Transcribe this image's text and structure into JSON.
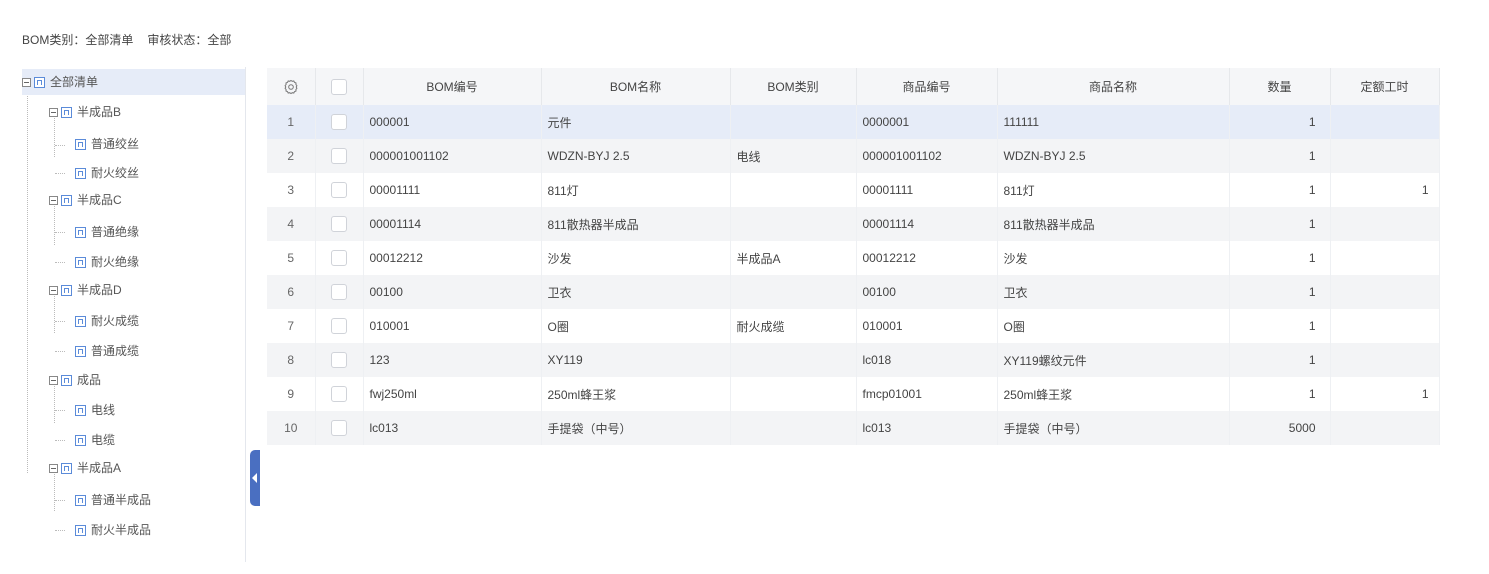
{
  "filter": {
    "category_label": "BOM类别：",
    "category_value": "全部清单",
    "status_label": "审核状态：",
    "status_value": "全部"
  },
  "tree": {
    "root": "全部清单",
    "groups": [
      {
        "label": "半成品B",
        "children": [
          "普通绞丝",
          "耐火绞丝"
        ]
      },
      {
        "label": "半成品C",
        "children": [
          "普通绝缘",
          "耐火绝缘"
        ]
      },
      {
        "label": "半成品D",
        "children": [
          "耐火成缆",
          "普通成缆"
        ]
      },
      {
        "label": "成品",
        "children": [
          "电线",
          "电缆"
        ]
      },
      {
        "label": "半成品A",
        "children": [
          "普通半成品",
          "耐火半成品"
        ]
      }
    ]
  },
  "table": {
    "settings_icon": "gear-icon",
    "columns": [
      "BOM编号",
      "BOM名称",
      "BOM类别",
      "商品编号",
      "商品名称",
      "数量",
      "定额工时"
    ],
    "rows": [
      {
        "idx": "1",
        "code": "000001",
        "name": "元件",
        "category": "",
        "product_code": "0000001",
        "product_name": "111111",
        "qty": "1",
        "hours": ""
      },
      {
        "idx": "2",
        "code": "000001001102",
        "name": "WDZN-BYJ 2.5",
        "category": "电线",
        "product_code": "000001001102",
        "product_name": "WDZN-BYJ 2.5",
        "qty": "1",
        "hours": ""
      },
      {
        "idx": "3",
        "code": "00001111",
        "name": "811灯",
        "category": "",
        "product_code": "00001111",
        "product_name": "811灯",
        "qty": "1",
        "hours": "1"
      },
      {
        "idx": "4",
        "code": "00001114",
        "name": "811散热器半成品",
        "category": "",
        "product_code": "00001114",
        "product_name": "811散热器半成品",
        "qty": "1",
        "hours": ""
      },
      {
        "idx": "5",
        "code": "00012212",
        "name": "沙发",
        "category": "半成品A",
        "product_code": "00012212",
        "product_name": "沙发",
        "qty": "1",
        "hours": ""
      },
      {
        "idx": "6",
        "code": "00100",
        "name": "卫衣",
        "category": "",
        "product_code": "00100",
        "product_name": "卫衣",
        "qty": "1",
        "hours": ""
      },
      {
        "idx": "7",
        "code": "010001",
        "name": "O圈",
        "category": "耐火成缆",
        "product_code": "010001",
        "product_name": "O圈",
        "qty": "1",
        "hours": ""
      },
      {
        "idx": "8",
        "code": "123",
        "name": "XY119",
        "category": "",
        "product_code": "lc018",
        "product_name": "XY119螺纹元件",
        "qty": "1",
        "hours": ""
      },
      {
        "idx": "9",
        "code": "fwj250ml",
        "name": "250ml蜂王浆",
        "category": "",
        "product_code": "fmcp01001",
        "product_name": "250ml蜂王浆",
        "qty": "1",
        "hours": "1"
      },
      {
        "idx": "10",
        "code": "lc013",
        "name": "手提袋（中号）",
        "category": "",
        "product_code": "lc013",
        "product_name": "手提袋（中号）",
        "qty": "5000",
        "hours": ""
      }
    ]
  }
}
